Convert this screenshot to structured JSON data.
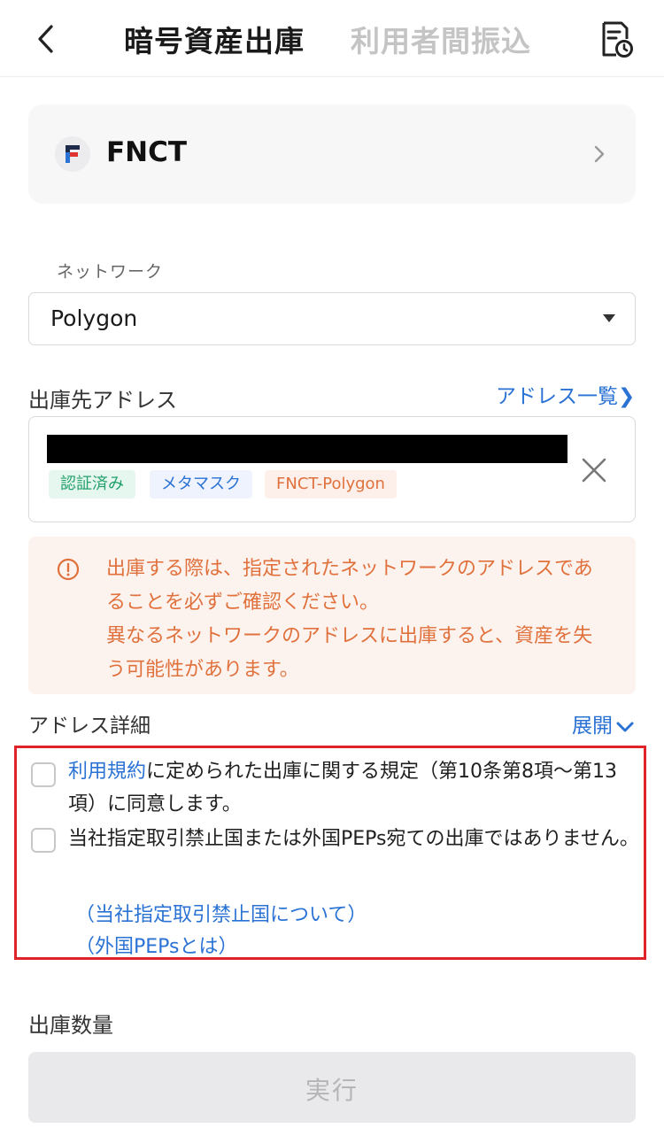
{
  "header": {
    "tab_active": "暗号資産出庫",
    "tab_inactive": "利用者間振込"
  },
  "asset": {
    "name": "FNCT",
    "logo_letter": "F"
  },
  "network": {
    "label": "ネットワーク",
    "value": "Polygon"
  },
  "address": {
    "label": "出庫先アドレス",
    "list_link": "アドレス一覧❯",
    "tags": [
      "認証済み",
      "メタマスク",
      "FNCT-Polygon"
    ]
  },
  "warning": {
    "line1": "出庫する際は、指定されたネットワークのアドレスであることを必ずご確認ください。",
    "line2": "異なるネットワークのアドレスに出庫すると、資産を失う可能性があります。"
  },
  "details": {
    "label": "アドレス詳細",
    "toggle": "展開"
  },
  "consent": {
    "item1_link": "利用規約",
    "item1_text": "に定められた出庫に関する規定（第10条第8項〜第13項）に同意します。",
    "item2_text": "当社指定取引禁止国または外国PEPs宛ての出庫ではありません。",
    "link_countries": "（当社指定取引禁止国について）",
    "link_peps": "（外国PEPsとは）"
  },
  "amount": {
    "label": "出庫数量"
  },
  "execute_label": "実行",
  "colors": {
    "accent_blue": "#2a72d4",
    "warning_orange": "#e0713d",
    "highlight_red": "#e0222a",
    "verified_green": "#22a06b"
  }
}
